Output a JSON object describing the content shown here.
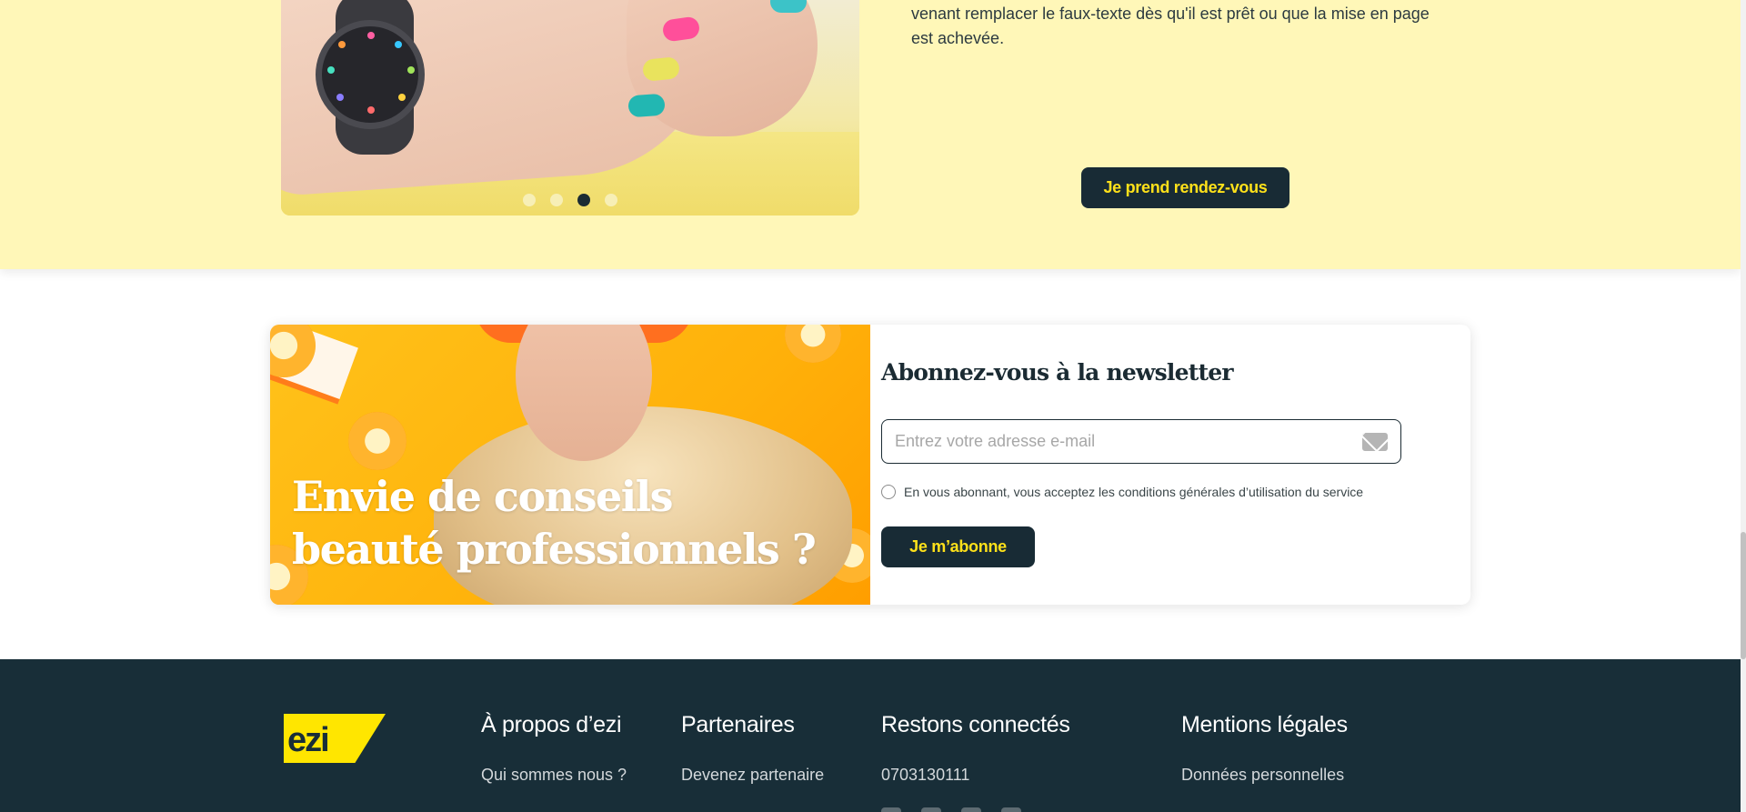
{
  "hero": {
    "text_line1": "venant remplacer le faux-texte dès qu'il est prêt ou que la mise en page",
    "text_line2": "est achevée.",
    "cta": "Je prend rendez-vous",
    "slider": {
      "count": 4,
      "active": 3
    }
  },
  "newsletter": {
    "title_line1": "Envie de conseils",
    "title_line2": "beauté professionnels ?",
    "heading": "Abonnez-vous à la newsletter",
    "email_placeholder": "Entrez votre adresse e-mail",
    "consent": "En vous abonnant, vous acceptez les conditions générales d’utilisation du service",
    "submit": "Je m’abonne"
  },
  "footer": {
    "logo": "ezi",
    "col1": {
      "title": "À propos d’ezi",
      "link": "Qui sommes nous ?"
    },
    "col2": {
      "title": "Partenaires",
      "link": "Devenez partenaire"
    },
    "col3": {
      "title": "Restons connectés",
      "phone": "0703130111"
    },
    "col4": {
      "title": "Mentions légales",
      "link": "Données personnelles"
    }
  },
  "colors": {
    "accent": "#ffe11a",
    "dark": "#182b35",
    "hero_bg": "#fff7b8"
  }
}
